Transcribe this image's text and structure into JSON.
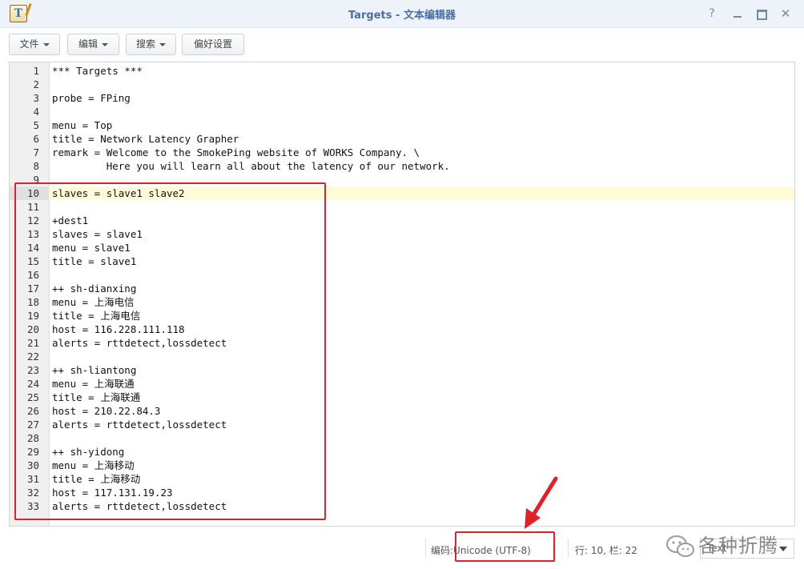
{
  "window": {
    "title": "Targets - 文本编辑器",
    "icon": "text-editor-icon",
    "controls": {
      "help": "?",
      "close": "✕"
    }
  },
  "toolbar": {
    "file": "文件",
    "edit": "编辑",
    "search": "搜索",
    "preferences": "偏好设置"
  },
  "editor": {
    "current_line": 10,
    "lines": [
      "*** Targets ***",
      "",
      "probe = FPing",
      "",
      "menu = Top",
      "title = Network Latency Grapher",
      "remark = Welcome to the SmokePing website of WORKS Company. \\",
      "         Here you will learn all about the latency of our network.",
      "",
      "slaves = slave1 slave2",
      "",
      "+dest1",
      "slaves = slave1",
      "menu = slave1",
      "title = slave1",
      "",
      "++ sh-dianxing",
      "menu = 上海电信",
      "title = 上海电信",
      "host = 116.228.111.118",
      "alerts = rttdetect,lossdetect",
      "",
      "++ sh-liantong",
      "menu = 上海联通",
      "title = 上海联通",
      "host = 210.22.84.3",
      "alerts = rttdetect,lossdetect",
      "",
      "++ sh-yidong",
      "menu = 上海移动",
      "title = 上海移动",
      "host = 117.131.19.23",
      "alerts = rttdetect,lossdetect"
    ]
  },
  "statusbar": {
    "encoding_label": "编码:",
    "encoding_value": "Unicode (UTF-8)",
    "position": "行: 10, 栏: 22",
    "mode": "Text",
    "watermark": "各种折腾"
  },
  "colors": {
    "annotation": "#e0202a",
    "current_line": "#fffbd9",
    "title": "#4a6da2"
  }
}
